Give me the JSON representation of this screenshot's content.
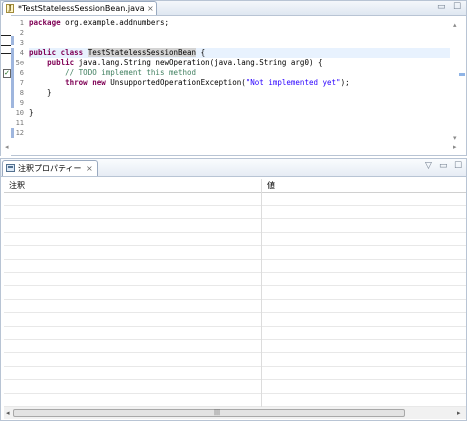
{
  "editor": {
    "tab_title": "*TestStatelessSessionBean.java",
    "tab_close": "×",
    "win_minimize": "▭",
    "win_maximize": "☐",
    "line_numbers": [
      "1",
      "2",
      "3",
      "4",
      "5⊖",
      "6",
      "7",
      "8",
      "9",
      "10",
      "11",
      "12"
    ]
  },
  "view": {
    "tab_title": "注釈プロパティー",
    "tab_close": "×",
    "menu": "▽",
    "win_minimize": "▭",
    "win_maximize": "☐",
    "columns": [
      "注釈",
      "値"
    ],
    "hscroll_left": "◂",
    "hscroll_right": "▸",
    "hscroll_grip": "|||"
  }
}
